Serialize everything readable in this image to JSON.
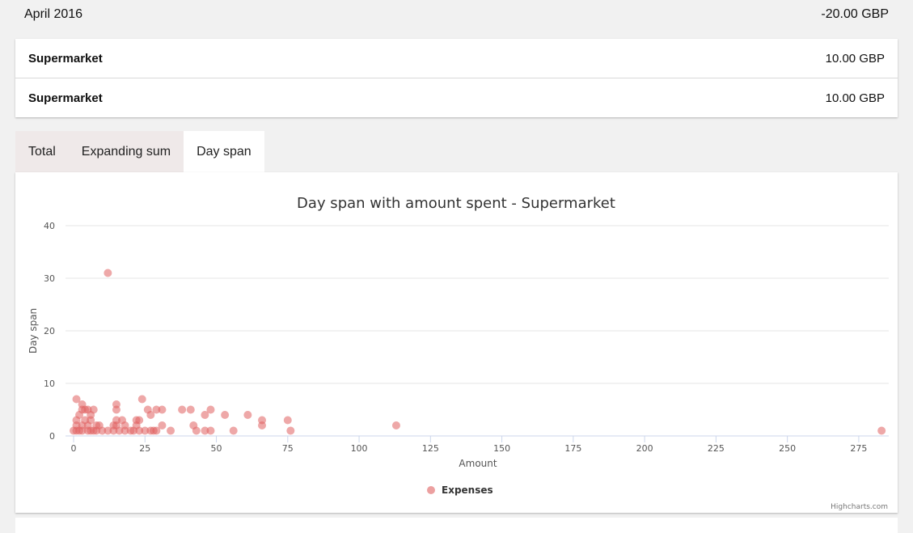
{
  "month": {
    "label": "April 2016",
    "total": "-20.00 GBP"
  },
  "transactions": [
    {
      "name": "Supermarket",
      "amount": "10.00 GBP"
    },
    {
      "name": "Supermarket",
      "amount": "10.00 GBP"
    }
  ],
  "tabs": [
    {
      "label": "Total",
      "active": false
    },
    {
      "label": "Expanding sum",
      "active": false
    },
    {
      "label": "Day span",
      "active": true
    }
  ],
  "credit": "Highcharts.com",
  "chart_data": {
    "type": "scatter",
    "title": "Day span with amount spent - Supermarket",
    "xlabel": "Amount",
    "ylabel": "Day span",
    "xlim": [
      0,
      285
    ],
    "ylim": [
      0,
      40
    ],
    "x_ticks": [
      0,
      25,
      50,
      75,
      100,
      125,
      150,
      175,
      200,
      225,
      250,
      275
    ],
    "y_ticks": [
      0,
      10,
      20,
      30,
      40
    ],
    "grid": "horizontal",
    "legend": "bottom-center",
    "series": [
      {
        "name": "Expenses",
        "color": "#e06060",
        "points": [
          [
            12,
            31
          ],
          [
            1,
            7
          ],
          [
            24,
            7
          ],
          [
            3,
            6
          ],
          [
            15,
            6
          ],
          [
            3,
            5
          ],
          [
            4,
            5
          ],
          [
            5,
            5
          ],
          [
            7,
            5
          ],
          [
            15,
            5
          ],
          [
            26,
            5
          ],
          [
            29,
            5
          ],
          [
            31,
            5
          ],
          [
            38,
            5
          ],
          [
            41,
            5
          ],
          [
            48,
            5
          ],
          [
            2,
            4
          ],
          [
            6,
            4
          ],
          [
            27,
            4
          ],
          [
            46,
            4
          ],
          [
            53,
            4
          ],
          [
            61,
            4
          ],
          [
            1,
            3
          ],
          [
            4,
            3
          ],
          [
            6,
            3
          ],
          [
            15,
            3
          ],
          [
            17,
            3
          ],
          [
            22,
            3
          ],
          [
            23,
            3
          ],
          [
            66,
            3
          ],
          [
            75,
            3
          ],
          [
            1,
            2
          ],
          [
            3,
            2
          ],
          [
            5,
            2
          ],
          [
            8,
            2
          ],
          [
            9,
            2
          ],
          [
            14,
            2
          ],
          [
            15,
            2
          ],
          [
            18,
            2
          ],
          [
            22,
            2
          ],
          [
            31,
            2
          ],
          [
            42,
            2
          ],
          [
            66,
            2
          ],
          [
            113,
            2
          ],
          [
            0,
            1
          ],
          [
            1,
            1
          ],
          [
            2,
            1
          ],
          [
            3,
            1
          ],
          [
            5,
            1
          ],
          [
            6,
            1
          ],
          [
            7,
            1
          ],
          [
            8,
            1
          ],
          [
            10,
            1
          ],
          [
            12,
            1
          ],
          [
            14,
            1
          ],
          [
            16,
            1
          ],
          [
            18,
            1
          ],
          [
            20,
            1
          ],
          [
            21,
            1
          ],
          [
            23,
            1
          ],
          [
            25,
            1
          ],
          [
            27,
            1
          ],
          [
            28,
            1
          ],
          [
            29,
            1
          ],
          [
            34,
            1
          ],
          [
            43,
            1
          ],
          [
            46,
            1
          ],
          [
            48,
            1
          ],
          [
            56,
            1
          ],
          [
            76,
            1
          ],
          [
            283,
            1
          ]
        ]
      }
    ]
  }
}
